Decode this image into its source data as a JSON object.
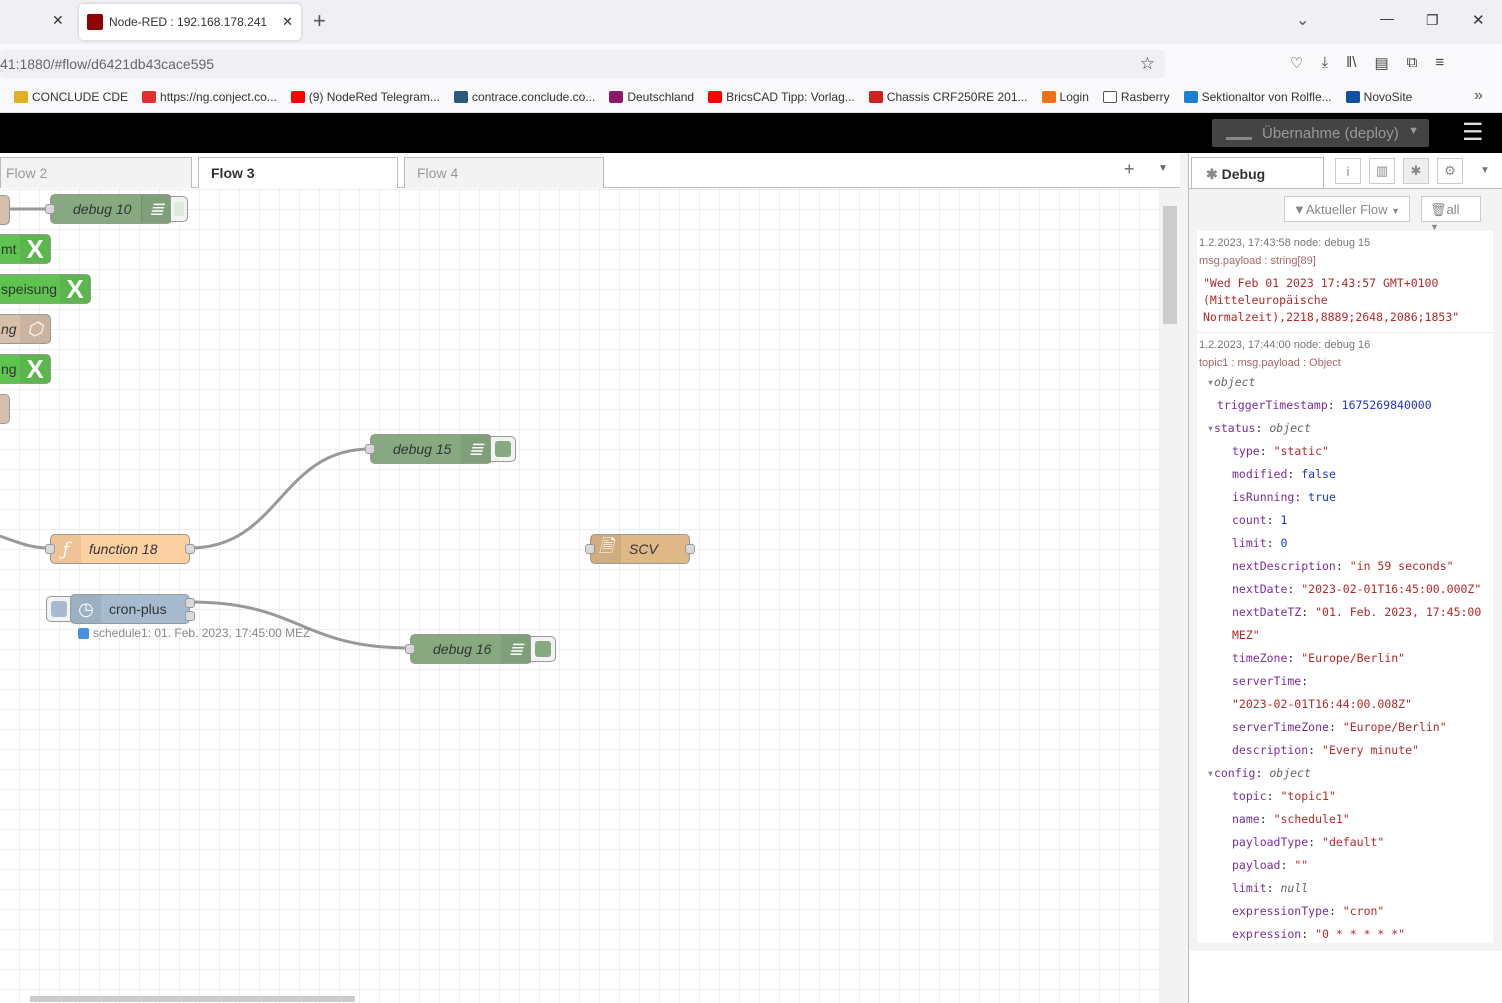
{
  "browser": {
    "tab_active": "Node-RED : 192.168.178.241",
    "url": "41:1880/#flow/d6421db43cace595",
    "bookmarks": [
      {
        "label": "CONCLUDE CDE",
        "color": "#e0b020"
      },
      {
        "label": "https://ng.conject.co...",
        "color": "#e03030"
      },
      {
        "label": "(9) NodeRed Telegram...",
        "color": "#ff0000"
      },
      {
        "label": "contrace.conclude.co...",
        "color": "#2a5a7a"
      },
      {
        "label": "Deutschland",
        "color": "#8b1a6b"
      },
      {
        "label": "BricsCAD Tipp: Vorlag...",
        "color": "#ff0000"
      },
      {
        "label": "Chassis CRF250RE 201...",
        "color": "#d02020"
      },
      {
        "label": "Login",
        "color": "#f07010"
      },
      {
        "label": "Rasberry",
        "color": "#ffffff"
      },
      {
        "label": "Sektionaltor von Rolfle...",
        "color": "#1a80d0"
      },
      {
        "label": "NovoSite",
        "color": "#1050a0"
      }
    ]
  },
  "header": {
    "deploy_label": "Übernahme (deploy)"
  },
  "workspace": {
    "tabs": [
      "Flow 2",
      "Flow 3",
      "Flow 4"
    ],
    "active": "Flow 3"
  },
  "nodes": {
    "debug10": "debug 10",
    "n_mt": "mt",
    "n_speisung": "speisung",
    "n_ng1": "ng",
    "n_ng2": "ng",
    "debug15": "debug 15",
    "function18": "function 18",
    "scv": "SCV",
    "cronplus": "cron-plus",
    "cron_status": "schedule1: 01. Feb. 2023, 17:45:00 MEZ",
    "debug16": "debug 16"
  },
  "sidebar": {
    "tab_label": "Debug",
    "filter_label": "Aktueller Flow",
    "clear_label": "all",
    "messages": [
      {
        "meta": "1.2.2023, 17:43:58   node: debug 15",
        "topic": "msg.payload : string[89]",
        "payload": "\"Wed Feb 01 2023 17:43:57 GMT+0100 (Mitteleuropäische Normalzeit),2218,8889;2648,2086;1853\""
      },
      {
        "meta": "1.2.2023, 17:44:00   node: debug 16",
        "topic": "topic1 : msg.payload : Object"
      }
    ],
    "tree": [
      {
        "indent": 0,
        "toggle": true,
        "key": "",
        "value": "object",
        "type": "t"
      },
      {
        "indent": 1,
        "key": "triggerTimestamp",
        "value": "1675269840000",
        "type": "n"
      },
      {
        "indent": 0,
        "toggle": true,
        "key": "status",
        "value": "object",
        "type": "t"
      },
      {
        "indent": 2,
        "key": "type",
        "value": "\"static\"",
        "type": "s"
      },
      {
        "indent": 2,
        "key": "modified",
        "value": "false",
        "type": "b"
      },
      {
        "indent": 2,
        "key": "isRunning",
        "value": "true",
        "type": "b"
      },
      {
        "indent": 2,
        "key": "count",
        "value": "1",
        "type": "n"
      },
      {
        "indent": 2,
        "key": "limit",
        "value": "0",
        "type": "n"
      },
      {
        "indent": 2,
        "key": "nextDescription",
        "value": "\"in 59 seconds\"",
        "type": "s"
      },
      {
        "indent": 2,
        "key": "nextDate",
        "value": "\"2023-02-01T16:45:00.000Z\"",
        "type": "s"
      },
      {
        "indent": 2,
        "key": "nextDateTZ",
        "value": "\"01. Feb. 2023, 17:45:00 MEZ\"",
        "type": "s"
      },
      {
        "indent": 2,
        "key": "timeZone",
        "value": "\"Europe/Berlin\"",
        "type": "s"
      },
      {
        "indent": 2,
        "key": "serverTime",
        "value": "\"2023-02-01T16:44:00.008Z\"",
        "type": "s",
        "wrap": true
      },
      {
        "indent": 2,
        "key": "serverTimeZone",
        "value": "\"Europe/Berlin\"",
        "type": "s"
      },
      {
        "indent": 2,
        "key": "description",
        "value": "\"Every minute\"",
        "type": "s"
      },
      {
        "indent": 0,
        "toggle": true,
        "key": "config",
        "value": "object",
        "type": "t"
      },
      {
        "indent": 2,
        "key": "topic",
        "value": "\"topic1\"",
        "type": "s"
      },
      {
        "indent": 2,
        "key": "name",
        "value": "\"schedule1\"",
        "type": "s"
      },
      {
        "indent": 2,
        "key": "payloadType",
        "value": "\"default\"",
        "type": "s"
      },
      {
        "indent": 2,
        "key": "payload",
        "value": "\"\"",
        "type": "s"
      },
      {
        "indent": 2,
        "key": "limit",
        "value": "null",
        "type": "t"
      },
      {
        "indent": 2,
        "key": "expressionType",
        "value": "\"cron\"",
        "type": "s"
      },
      {
        "indent": 2,
        "key": "expression",
        "value": "\"0 * * * * *\"",
        "type": "s"
      }
    ]
  }
}
